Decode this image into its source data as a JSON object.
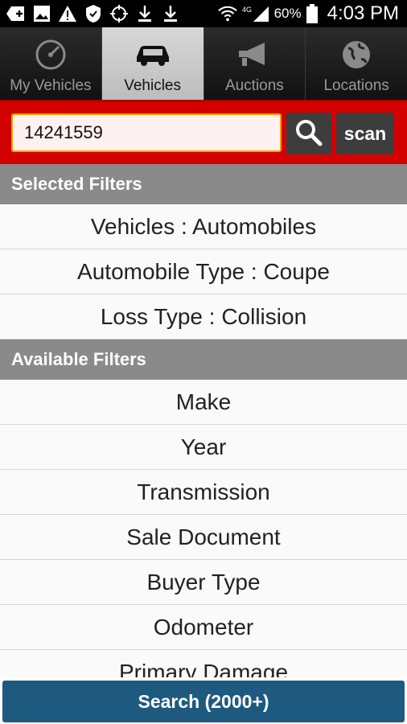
{
  "status_bar": {
    "battery_pct": "60%",
    "time": "4:03 PM",
    "network": "4G"
  },
  "tabs": [
    {
      "label": "My Vehicles",
      "icon": "speedometer-icon",
      "active": false
    },
    {
      "label": "Vehicles",
      "icon": "car-icon",
      "active": true
    },
    {
      "label": "Auctions",
      "icon": "megaphone-icon",
      "active": false
    },
    {
      "label": "Locations",
      "icon": "globe-icon",
      "active": false
    }
  ],
  "search": {
    "value": "14241559",
    "scan_label": "scan"
  },
  "selected_filters": {
    "header": "Selected Filters",
    "items": [
      "Vehicles : Automobiles",
      "Automobile Type : Coupe",
      "Loss Type : Collision"
    ]
  },
  "available_filters": {
    "header": "Available Filters",
    "items": [
      "Make",
      "Year",
      "Transmission",
      "Sale Document",
      "Buyer Type",
      "Odometer",
      "Primary Damage"
    ]
  },
  "bottom_button": {
    "label": "Search (2000+)"
  },
  "colors": {
    "accent_red": "#d40000",
    "search_button_blue": "#1e5a7f",
    "section_gray": "#8a8a8a"
  }
}
